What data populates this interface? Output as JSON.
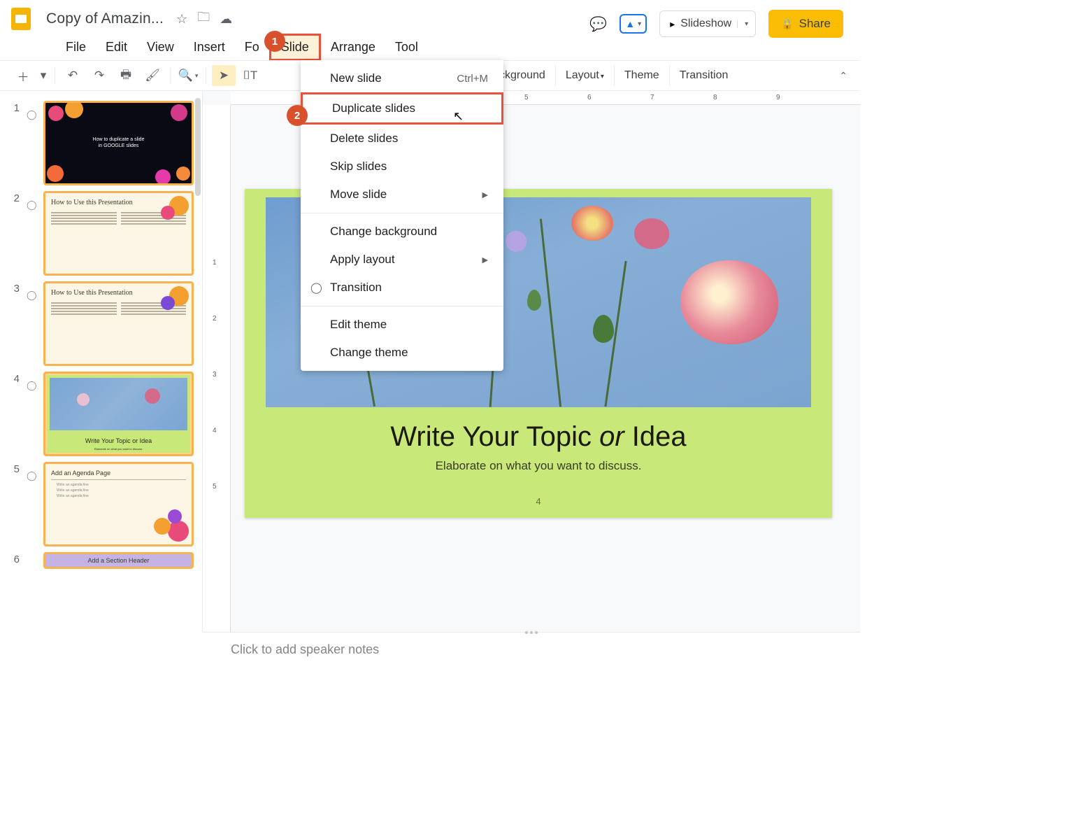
{
  "app": {
    "doc_title": "Copy of Amazin..."
  },
  "menubar": {
    "file": "File",
    "edit": "Edit",
    "view": "View",
    "insert": "Insert",
    "format": "Fo",
    "slide": "Slide",
    "arrange": "Arrange",
    "tools": "Tool"
  },
  "header_right": {
    "slideshow": "Slideshow",
    "share": "Share"
  },
  "toolbar_labels": {
    "background": "ckground",
    "layout": "Layout",
    "theme": "Theme",
    "transition": "Transition"
  },
  "dropdown": {
    "new_slide": "New slide",
    "new_slide_sc": "Ctrl+M",
    "duplicate": "Duplicate slides",
    "delete": "Delete slides",
    "skip": "Skip slides",
    "move": "Move slide",
    "change_bg": "Change background",
    "apply_layout": "Apply layout",
    "transition": "Transition",
    "edit_theme": "Edit theme",
    "change_theme": "Change theme"
  },
  "badges": {
    "one": "1",
    "two": "2"
  },
  "thumbs": {
    "t1_l1": "How to duplicate a slide",
    "t1_l2": "in GOOGLE slides",
    "t2_title": "How to Use this Presentation",
    "t3_title": "How to Use this Presentation",
    "t4_title": "Write Your Topic or Idea",
    "t4_sub": "Elaborate on what you want to discuss.",
    "t5_title": "Add an Agenda Page",
    "t5_li": "Write an agenda line",
    "t6_title": "Add a Section Header"
  },
  "canvas": {
    "title_pre": "Write Your Topic ",
    "title_em": "or",
    "title_post": " Idea",
    "sub": "Elaborate on what you want to discuss.",
    "page": "4"
  },
  "ruler_h": [
    "5",
    "6",
    "7",
    "8",
    "9"
  ],
  "ruler_v": [
    "1",
    "2",
    "3",
    "4",
    "5"
  ],
  "notes": {
    "placeholder": "Click to add speaker notes"
  }
}
